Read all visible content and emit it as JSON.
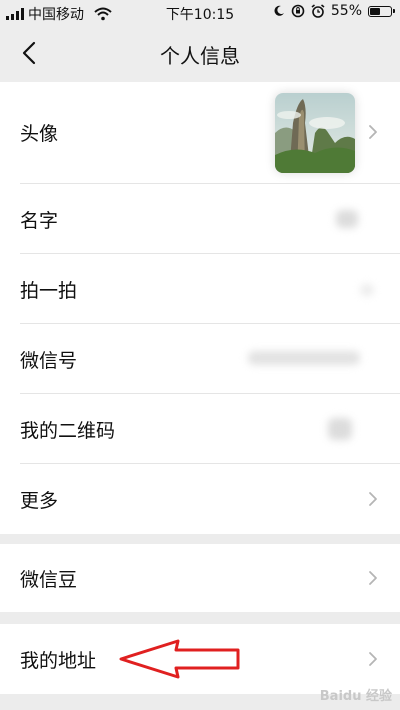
{
  "status": {
    "carrier": "中国移动",
    "time": "下午10:15",
    "battery": "55%",
    "battery_level": 0.55
  },
  "header": {
    "title": "个人信息"
  },
  "profile_items": [
    {
      "label": "头像"
    },
    {
      "label": "名字"
    },
    {
      "label": "拍一拍"
    },
    {
      "label": "微信号"
    },
    {
      "label": "我的二维码"
    },
    {
      "label": "更多"
    }
  ],
  "wechat_beans": {
    "label": "微信豆"
  },
  "address": {
    "label": "我的地址"
  },
  "watermark": "Baidu 经验",
  "icons": {
    "back": "chevron-left-icon",
    "row_arrow": "chevron-right-icon",
    "wifi": "wifi-icon",
    "moon": "moon-icon",
    "alarm": "alarm-icon",
    "lock_rotation": "rotation-lock-icon",
    "annotation": "red-arrow-icon"
  },
  "colors": {
    "background": "#ececec",
    "card": "#ffffff",
    "annotation_red": "#e02020"
  }
}
